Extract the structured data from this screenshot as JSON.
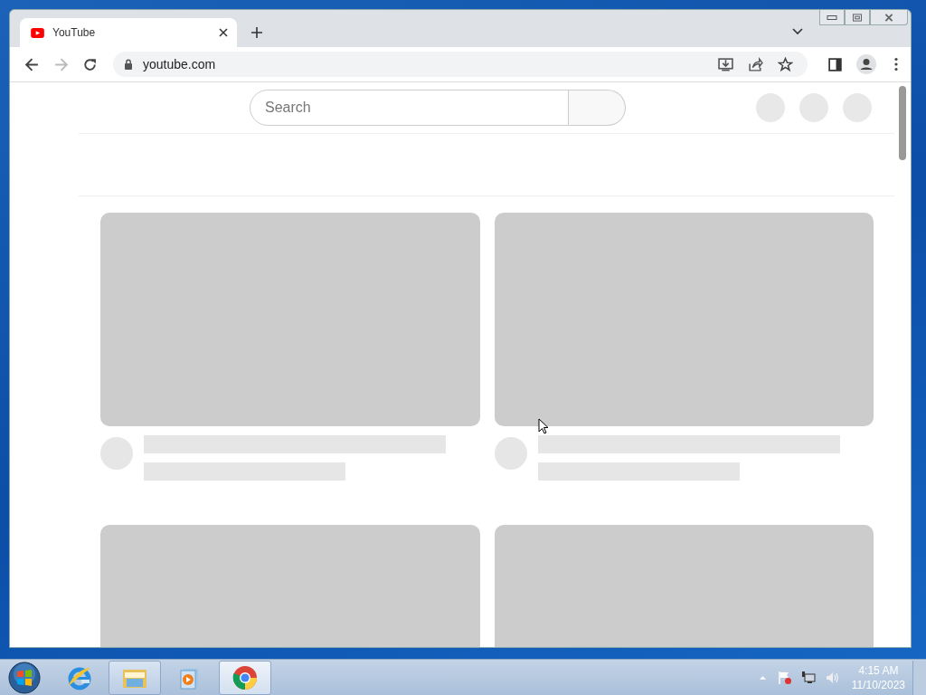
{
  "browser": {
    "tabs": [
      {
        "title": "YouTube",
        "selected": true
      }
    ],
    "address_bar": {
      "url": "youtube.com"
    }
  },
  "page": {
    "search": {
      "placeholder": "Search"
    },
    "video_grid": [
      {
        "kind": "skeleton"
      },
      {
        "kind": "skeleton"
      },
      {
        "kind": "thumbnail_only"
      },
      {
        "kind": "thumbnail_only"
      }
    ]
  },
  "taskbar": {
    "apps": [
      {
        "kind": "ie",
        "running": false,
        "selected": false
      },
      {
        "kind": "explorer",
        "running": true,
        "selected": false
      },
      {
        "kind": "media",
        "running": false,
        "selected": false
      },
      {
        "kind": "chrome",
        "running": true,
        "selected": true
      }
    ],
    "clock": {
      "time": "4:15 AM",
      "date": "11/10/2023"
    }
  }
}
